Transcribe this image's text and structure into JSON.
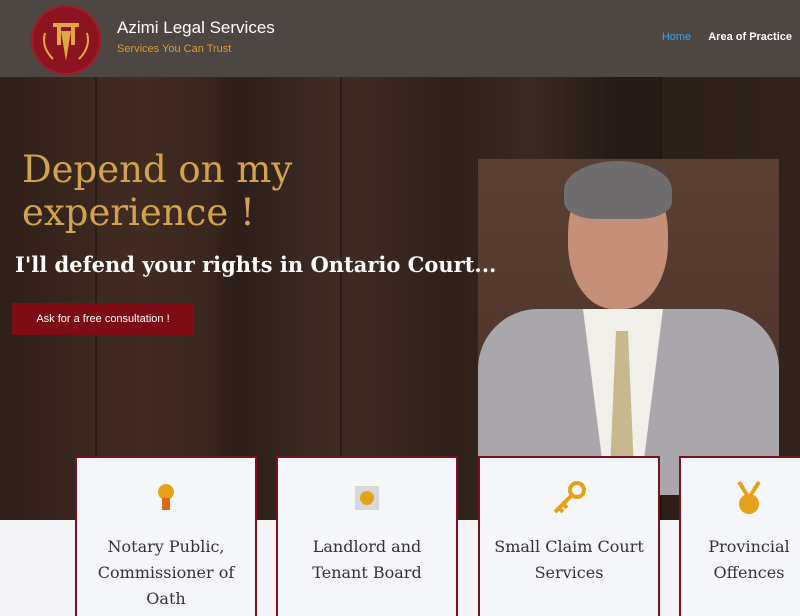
{
  "header": {
    "brand": "Azimi Legal Services",
    "tagline": "Services You Can Trust",
    "nav": [
      "Home",
      "Area of Practice"
    ]
  },
  "hero": {
    "headline": "Depend on my experience !",
    "subheadline": "I'll defend your rights in Ontario Court...",
    "cta_label": "Ask for a free consultation !"
  },
  "cards": [
    {
      "title": "Notary Public, Commissioner of Oath",
      "icon": "award-icon"
    },
    {
      "title": "Landlord and Tenant Board",
      "icon": "badge-icon"
    },
    {
      "title": "Small Claim Court Services",
      "icon": "key-icon"
    },
    {
      "title": "Provincial Offences",
      "icon": "medal-icon"
    }
  ],
  "colors": {
    "header_bg": "#4e4642",
    "accent_gold": "#d3a24a",
    "cta_red": "#7d0d14",
    "nav_active": "#3ea0e8"
  }
}
